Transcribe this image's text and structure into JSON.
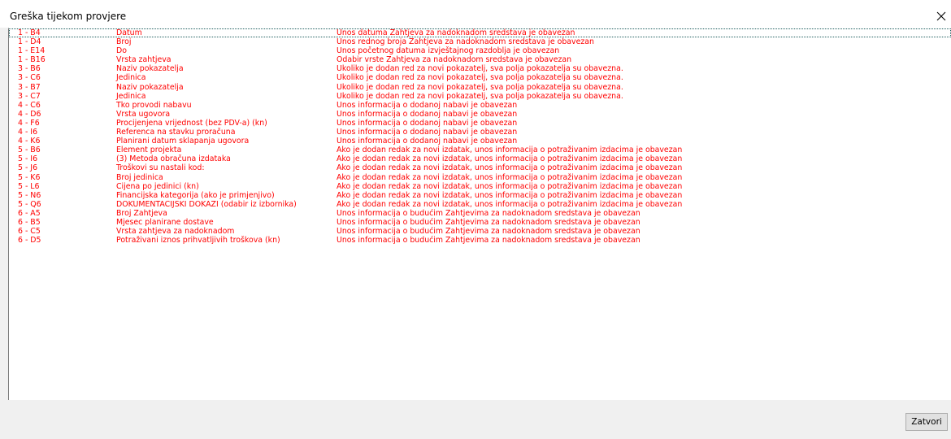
{
  "window": {
    "title": "Greška tijekom provjere",
    "close_glyph": "✕"
  },
  "footer": {
    "close_label": "Zatvori"
  },
  "colors": {
    "error_text": "#ff0000"
  },
  "errors": [
    {
      "ref": "1 - B4",
      "field": "Datum",
      "message": "Unos datuma Zahtjeva za nadoknadom sredstava je obavezan"
    },
    {
      "ref": "1 - D4",
      "field": "Broj",
      "message": "Unos rednog broja Zahtjeva za nadoknadom sredstava je obavezan"
    },
    {
      "ref": "1 - E14",
      "field": "Do",
      "message": "Unos početnog datuma izvještajnog razdoblja je obavezan"
    },
    {
      "ref": "1 - B16",
      "field": "Vrsta zahtjeva",
      "message": "Odabir vrste Zahtjeva za nadoknadom sredstava je obavezan"
    },
    {
      "ref": "3 - B6",
      "field": "Naziv pokazatelja",
      "message": "Ukoliko je dodan red za novi pokazatelj, sva polja pokazatelja su obavezna."
    },
    {
      "ref": "3 - C6",
      "field": "Jedinica",
      "message": "Ukoliko je dodan red za novi pokazatelj, sva polja pokazatelja su obavezna."
    },
    {
      "ref": "3 - B7",
      "field": "Naziv pokazatelja",
      "message": "Ukoliko je dodan red za novi pokazatelj, sva polja pokazatelja su obavezna."
    },
    {
      "ref": "3 - C7",
      "field": "Jedinica",
      "message": "Ukoliko je dodan red za novi pokazatelj, sva polja pokazatelja su obavezna."
    },
    {
      "ref": "4 - C6",
      "field": "Tko provodi nabavu",
      "message": "Unos informacija o dodanoj nabavi je obavezan"
    },
    {
      "ref": "4 - D6",
      "field": "Vrsta ugovora",
      "message": "Unos informacija o dodanoj nabavi je obavezan"
    },
    {
      "ref": "4 - F6",
      "field": "Procijenjena vrijednost (bez PDV-a) (kn)",
      "message": "Unos informacija o dodanoj nabavi je obavezan"
    },
    {
      "ref": "4 - I6",
      "field": "Referenca na stavku proračuna",
      "message": "Unos informacija o dodanoj nabavi je obavezan"
    },
    {
      "ref": "4 - K6",
      "field": "Planirani datum sklapanja ugovora",
      "message": "Unos informacija o dodanoj nabavi je obavezan"
    },
    {
      "ref": "5 - B6",
      "field": "Element projekta",
      "message": "Ako je dodan redak za novi izdatak, unos informacija o potraživanim izdacima je obavezan"
    },
    {
      "ref": "5 - I6",
      "field": "(3) Metoda obračuna izdataka",
      "message": "Ako je dodan redak za novi izdatak, unos informacija o potraživanim izdacima je obavezan"
    },
    {
      "ref": "5 - J6",
      "field": "Troškovi su nastali kod:",
      "message": "Ako je dodan redak za novi izdatak, unos informacija o potraživanim izdacima je obavezan"
    },
    {
      "ref": "5 - K6",
      "field": "Broj jedinica",
      "message": "Ako je dodan redak za novi izdatak, unos informacija o potraživanim izdacima je obavezan"
    },
    {
      "ref": "5 - L6",
      "field": "Cijena po jedinici (kn)",
      "message": "Ako je dodan redak za novi izdatak, unos informacija o potraživanim izdacima je obavezan"
    },
    {
      "ref": "5 - N6",
      "field": "Financijska kategorija (ako je primjenjivo)",
      "message": "Ako je dodan redak za novi izdatak, unos informacija o potraživanim izdacima je obavezan"
    },
    {
      "ref": "5 - Q6",
      "field": "DOKUMENTACIJSKI DOKAZI (odabir iz izbornika)",
      "message": "Ako je dodan redak za novi izdatak, unos informacija o potraživanim izdacima je obavezan"
    },
    {
      "ref": "6 - A5",
      "field": "Broj Zahtjeva",
      "message": "Unos informacija o budućim Zahtjevima za nadoknadom sredstava je obavezan"
    },
    {
      "ref": "6 - B5",
      "field": "Mjesec planirane dostave",
      "message": "Unos informacija o budućim Zahtjevima za nadoknadom sredstava je obavezan"
    },
    {
      "ref": "6 - C5",
      "field": "Vrsta  zahtjeva za nadoknadom",
      "message": "Unos informacija o budućim Zahtjevima za nadoknadom sredstava je obavezan"
    },
    {
      "ref": "6 - D5",
      "field": "Potraživani iznos prihvatljivih troškova (kn)",
      "message": "Unos informacija o budućim Zahtjevima za nadoknadom sredstava je obavezan"
    }
  ]
}
